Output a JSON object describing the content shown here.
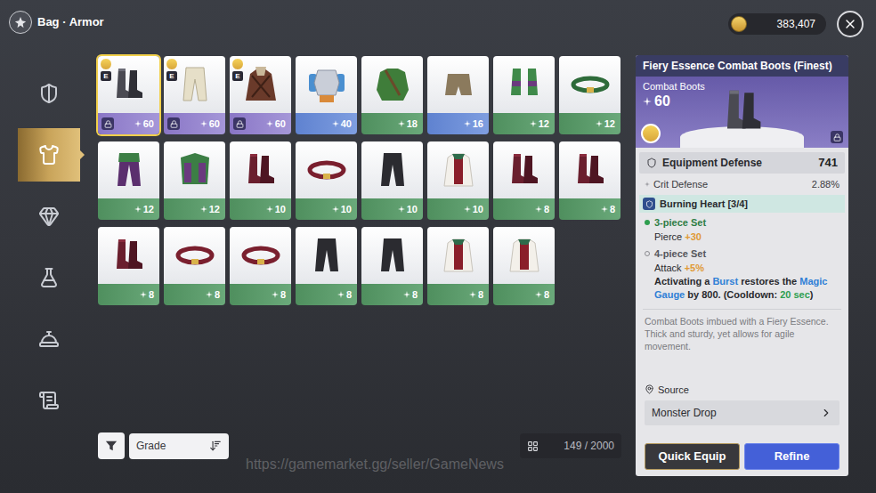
{
  "header": {
    "title": "Bag · Armor",
    "gold": "383,407"
  },
  "sidebar": [
    {
      "kind": "weapon",
      "selected": false
    },
    {
      "kind": "armor",
      "selected": true
    },
    {
      "kind": "accessory",
      "selected": false
    },
    {
      "kind": "potion",
      "selected": false
    },
    {
      "kind": "food",
      "selected": false
    },
    {
      "kind": "scroll",
      "selected": false
    }
  ],
  "items": [
    {
      "kind": "boots",
      "rarity": "legendary",
      "enhance": "60",
      "grade": "E",
      "locked": true,
      "selected": true
    },
    {
      "kind": "trousers",
      "rarity": "legendary",
      "enhance": "60",
      "grade": "E",
      "locked": true,
      "selected": false
    },
    {
      "kind": "coat",
      "rarity": "legendary",
      "enhance": "60",
      "grade": "E",
      "locked": true,
      "selected": false
    },
    {
      "kind": "cuirass",
      "rarity": "rare",
      "enhance": "40",
      "grade": "",
      "locked": false,
      "selected": false
    },
    {
      "kind": "tunic",
      "rarity": "uncommon",
      "enhance": "18",
      "grade": "",
      "locked": false,
      "selected": false
    },
    {
      "kind": "shorts",
      "rarity": "rare",
      "enhance": "16",
      "grade": "",
      "locked": false,
      "selected": false
    },
    {
      "kind": "greaves",
      "rarity": "uncommon",
      "enhance": "12",
      "grade": "",
      "locked": false,
      "selected": false
    },
    {
      "kind": "sash",
      "rarity": "uncommon",
      "enhance": "12",
      "grade": "",
      "locked": false,
      "selected": false
    },
    {
      "kind": "leggings",
      "rarity": "uncommon",
      "enhance": "12",
      "grade": "",
      "locked": false,
      "selected": false
    },
    {
      "kind": "mantle",
      "rarity": "uncommon",
      "enhance": "12",
      "grade": "",
      "locked": false,
      "selected": false
    },
    {
      "kind": "boots",
      "rarity": "uncommon",
      "enhance": "10",
      "grade": "",
      "locked": false,
      "selected": false
    },
    {
      "kind": "belt",
      "rarity": "uncommon",
      "enhance": "10",
      "grade": "",
      "locked": false,
      "selected": false
    },
    {
      "kind": "pants",
      "rarity": "uncommon",
      "enhance": "10",
      "grade": "",
      "locked": false,
      "selected": false
    },
    {
      "kind": "shirt",
      "rarity": "uncommon",
      "enhance": "10",
      "grade": "",
      "locked": false,
      "selected": false
    },
    {
      "kind": "boots",
      "rarity": "uncommon",
      "enhance": "8",
      "grade": "",
      "locked": false,
      "selected": false
    },
    {
      "kind": "boots",
      "rarity": "uncommon",
      "enhance": "8",
      "grade": "",
      "locked": false,
      "selected": false
    },
    {
      "kind": "boots",
      "rarity": "uncommon",
      "enhance": "8",
      "grade": "",
      "locked": false,
      "selected": false
    },
    {
      "kind": "belt",
      "rarity": "uncommon",
      "enhance": "8",
      "grade": "",
      "locked": false,
      "selected": false
    },
    {
      "kind": "belt",
      "rarity": "uncommon",
      "enhance": "8",
      "grade": "",
      "locked": false,
      "selected": false
    },
    {
      "kind": "pants",
      "rarity": "uncommon",
      "enhance": "8",
      "grade": "",
      "locked": false,
      "selected": false
    },
    {
      "kind": "pants",
      "rarity": "uncommon",
      "enhance": "8",
      "grade": "",
      "locked": false,
      "selected": false
    },
    {
      "kind": "shirt",
      "rarity": "uncommon",
      "enhance": "8",
      "grade": "",
      "locked": false,
      "selected": false
    },
    {
      "kind": "shirt",
      "rarity": "uncommon",
      "enhance": "8",
      "grade": "",
      "locked": false,
      "selected": false
    }
  ],
  "sort": {
    "label": "Grade"
  },
  "capacity": "149 / 2000",
  "detail": {
    "name": "Fiery Essence Combat Boots (Finest)",
    "type": "Combat Boots",
    "enhance": "60",
    "locked": true,
    "main_stat": {
      "name": "Equipment Defense",
      "value": "741"
    },
    "sub_stats": [
      {
        "name": "Crit Defense",
        "value": "2.88%"
      }
    ],
    "set": {
      "name": "Burning Heart [3/4]",
      "bonuses": [
        {
          "label": "3-piece Set",
          "active": true,
          "stats": [
            {
              "name": "Pierce",
              "value": "+30"
            }
          ],
          "effect": []
        },
        {
          "label": "4-piece Set",
          "active": false,
          "stats": [
            {
              "name": "Attack",
              "value": "+5%"
            }
          ],
          "effect": [
            {
              "text": "Activating a ",
              "color": "#2a2a2e"
            },
            {
              "text": "Burst",
              "color": "#2f7fd6"
            },
            {
              "text": " restores the ",
              "color": "#2a2a2e"
            },
            {
              "text": "Magic Gauge",
              "color": "#2f7fd6"
            },
            {
              "text": " by 800. (Cooldown: ",
              "color": "#2a2a2e"
            },
            {
              "text": "20 sec",
              "color": "#2e9e4f"
            },
            {
              "text": ")",
              "color": "#2a2a2e"
            }
          ]
        }
      ]
    },
    "description": "Combat Boots imbued with a Fiery Essence. Thick and sturdy, yet allows for agile movement.",
    "source_label": "Source",
    "source": "Monster Drop",
    "buttons": [
      {
        "label": "Quick Equip",
        "kind": "secondary"
      },
      {
        "label": "Refine",
        "kind": "primary"
      }
    ]
  },
  "watermark": "https://gamemarket.gg/seller/GameNews"
}
